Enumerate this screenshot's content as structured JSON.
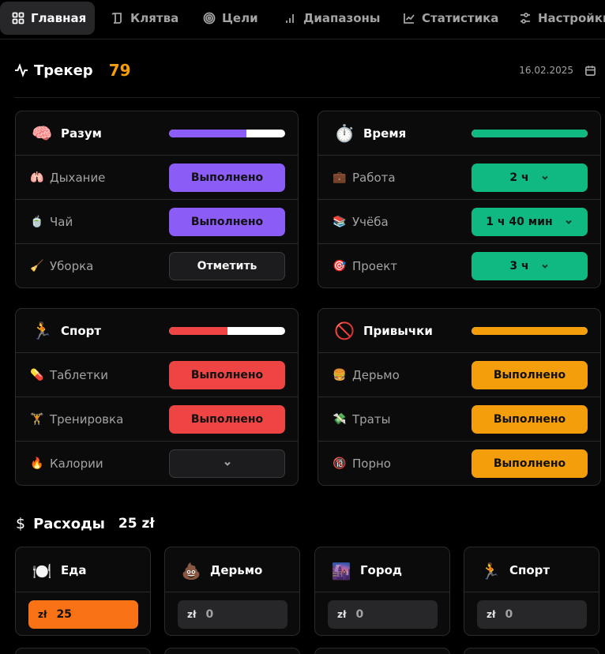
{
  "nav": {
    "tabs": [
      {
        "label": "Главная",
        "icon": "grid-icon",
        "active": true
      },
      {
        "label": "Клятва",
        "icon": "scroll-icon",
        "active": false
      },
      {
        "label": "Цели",
        "icon": "target-icon",
        "active": false
      },
      {
        "label": "Диапазоны",
        "icon": "bar-chart-icon",
        "active": false
      },
      {
        "label": "Статистика",
        "icon": "line-chart-icon",
        "active": false
      },
      {
        "label": "Настройки",
        "icon": "sliders-icon",
        "active": false
      }
    ]
  },
  "tracker": {
    "title": "Трекер",
    "score": "79",
    "date": "16.02.2025",
    "colors": {
      "score": "#f59e0b"
    }
  },
  "categories": [
    {
      "name": "Разум",
      "emoji": "🧠",
      "accent": "#8b5cf6",
      "progress": 0.67,
      "items": [
        {
          "icon": "🫁",
          "label": "Дыхание",
          "action": "Выполнено"
        },
        {
          "icon": "🍵",
          "label": "Чай",
          "action": "Выполнено"
        },
        {
          "icon": "🧹",
          "label": "Уборка",
          "action": "Отметить"
        }
      ]
    },
    {
      "name": "Время",
      "emoji": "⏱️",
      "accent": "#10b981",
      "progress": 1.0,
      "items": [
        {
          "icon": "💼",
          "label": "Работа",
          "action": "2 ч"
        },
        {
          "icon": "📚",
          "label": "Учёба",
          "action": "1 ч 40 мин"
        },
        {
          "icon": "🎯",
          "label": "Проект",
          "action": "3 ч"
        }
      ]
    },
    {
      "name": "Спорт",
      "emoji": "🏃",
      "accent": "#ef4444",
      "progress": 0.5,
      "items": [
        {
          "icon": "💊",
          "label": "Таблетки",
          "action": "Выполнено"
        },
        {
          "icon": "🏋️",
          "label": "Тренировка",
          "action": "Выполнено"
        },
        {
          "icon": "🔥",
          "label": "Калории",
          "action": ""
        }
      ]
    },
    {
      "name": "Привычки",
      "emoji": "🚫",
      "accent": "#f59e0b",
      "progress": 1.0,
      "items": [
        {
          "icon": "🍔",
          "label": "Дерьмо",
          "action": "Выполнено"
        },
        {
          "icon": "💸",
          "label": "Траты",
          "action": "Выполнено"
        },
        {
          "icon": "🔞",
          "label": "Порно",
          "action": "Выполнено"
        }
      ]
    }
  ],
  "expenses": {
    "title": "Расходы",
    "total": "25 zł",
    "currency": "zł",
    "items": [
      {
        "emoji": "🍽️",
        "name": "Еда",
        "amount": "25",
        "highlight": "#f97316"
      },
      {
        "emoji": "💩",
        "name": "Дерьмо",
        "amount": "0"
      },
      {
        "emoji": "🌆",
        "name": "Город",
        "amount": "0"
      },
      {
        "emoji": "🏃",
        "name": "Спорт",
        "amount": "0"
      }
    ]
  }
}
